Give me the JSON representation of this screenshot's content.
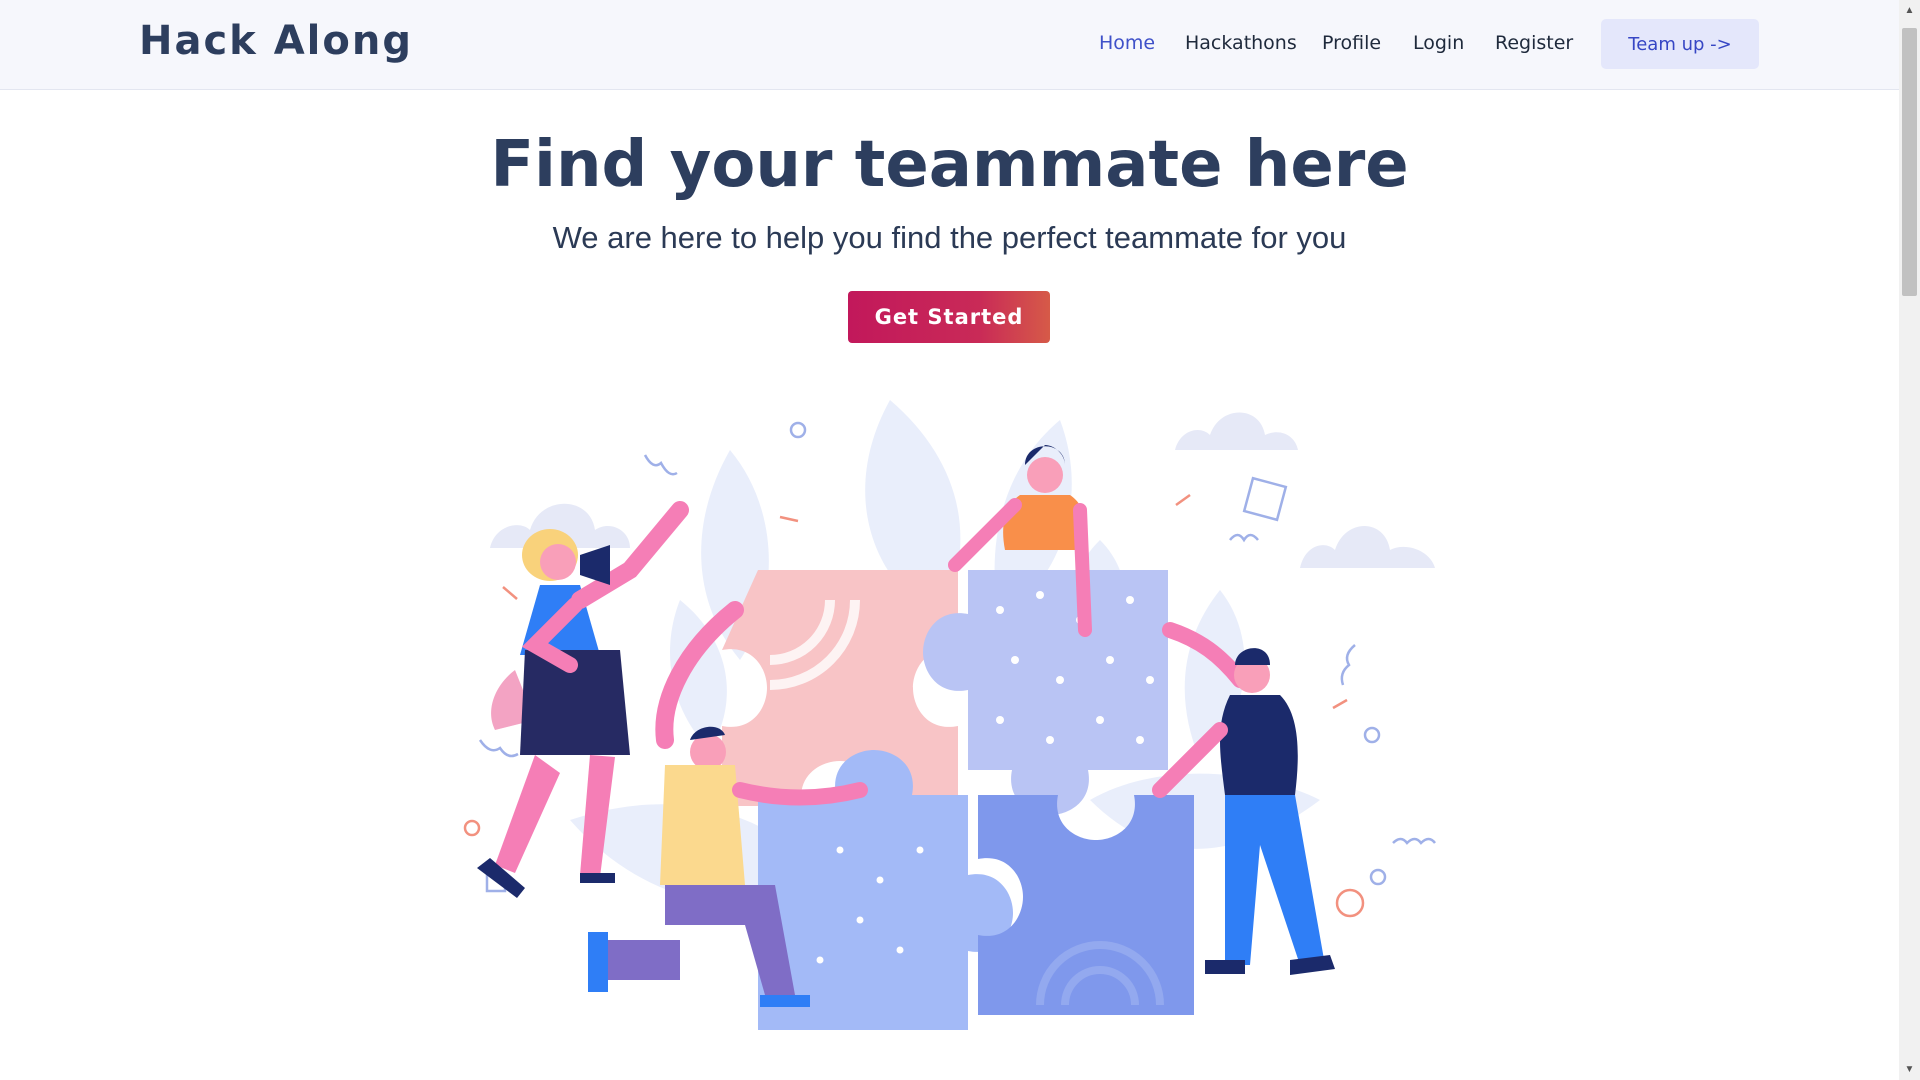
{
  "brand": {
    "name": "Hack Along"
  },
  "nav": {
    "items": [
      {
        "label": "Home",
        "active": true
      },
      {
        "label": "Hackathons"
      },
      {
        "label": "Profile"
      },
      {
        "label": "Login"
      },
      {
        "label": "Register"
      }
    ],
    "cta_label": "Team up ->"
  },
  "hero": {
    "title": "Find your teammate here",
    "subtitle": "We are here to help you find the perfect teammate for you",
    "button_label": "Get Started"
  },
  "colors": {
    "accent": "#3f51c9",
    "heading": "#2d3e5e",
    "button_start": "#c2185b",
    "button_end": "#d65a48"
  },
  "illustration": {
    "icon": "team-puzzle-illustration"
  }
}
